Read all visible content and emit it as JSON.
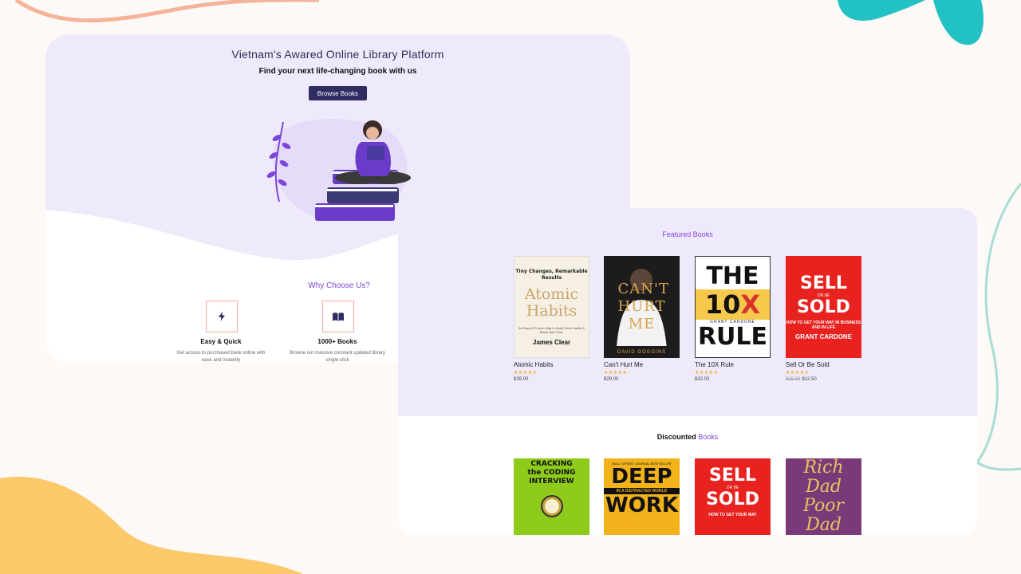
{
  "hero": {
    "title": "Vietnam's Awared Online Library Platform",
    "subtitle": "Find your next life-changing book with us",
    "browse_button": "Browse Books"
  },
  "why": {
    "title": "Why Choose Us?",
    "features": [
      {
        "icon": "lightning-icon",
        "title": "Easy & Quick",
        "desc": "Get access to purchased book online with ease and instantly"
      },
      {
        "icon": "book-icon",
        "title": "1000+ Books",
        "desc": "Browse our massive constant updated library single-click"
      }
    ]
  },
  "featured": {
    "title": "Featured Books",
    "books": [
      {
        "title": "Atomic Habits",
        "price": "$39.00",
        "rating": "★★★★★",
        "cover": {
          "tag": "Tiny Changes, Remarkable Results",
          "big": "Atomic Habits",
          "small": "An Easy & Proven Way to Build Good Habits & Break Bad Ones",
          "author": "James Clear"
        }
      },
      {
        "title": "Can't Hurt Me",
        "price": "$29.00",
        "rating": "★★★★★",
        "cover": {
          "big": "CAN'T HURT ME",
          "author": "DAVID GOGGINS"
        }
      },
      {
        "title": "The 10X Rule",
        "price": "$32.00",
        "rating": "★★★★★",
        "cover": {
          "top": "THE",
          "mid": "10",
          "mid2": "X",
          "author": "GRANT CARDONE",
          "bottom": "RULE"
        }
      },
      {
        "title": "Sell Or Be Sold",
        "old_price": "$15.00",
        "price": "$12.50",
        "rating": "★★★★★",
        "cover": {
          "top": "SELL",
          "or": "OR BE",
          "big": "SOLD",
          "sub": "HOW TO GET YOUR WAY IN BUSINESS AND IN LIFE",
          "author": "GRANT CARDONE"
        }
      }
    ]
  },
  "discounted": {
    "title_a": "Discounted",
    "title_b": "Books",
    "covers": [
      {
        "big": "CRACKING the CODING INTERVIEW"
      },
      {
        "strip_top": "WALL STREET JOURNAL BESTSELLER",
        "top": "DEEP",
        "strip": "IN A DISTRACTED WORLD",
        "bottom": "WORK"
      },
      {
        "top": "SELL",
        "or": "OR BE",
        "big": "SOLD",
        "sub": "HOW TO GET YOUR WAY"
      },
      {
        "big": "Rich Dad Poor Dad"
      }
    ]
  },
  "colors": {
    "accent": "#7b46d9",
    "button": "#2f2b63",
    "hero_bg": "#efeafb",
    "star": "#f2b01e"
  }
}
